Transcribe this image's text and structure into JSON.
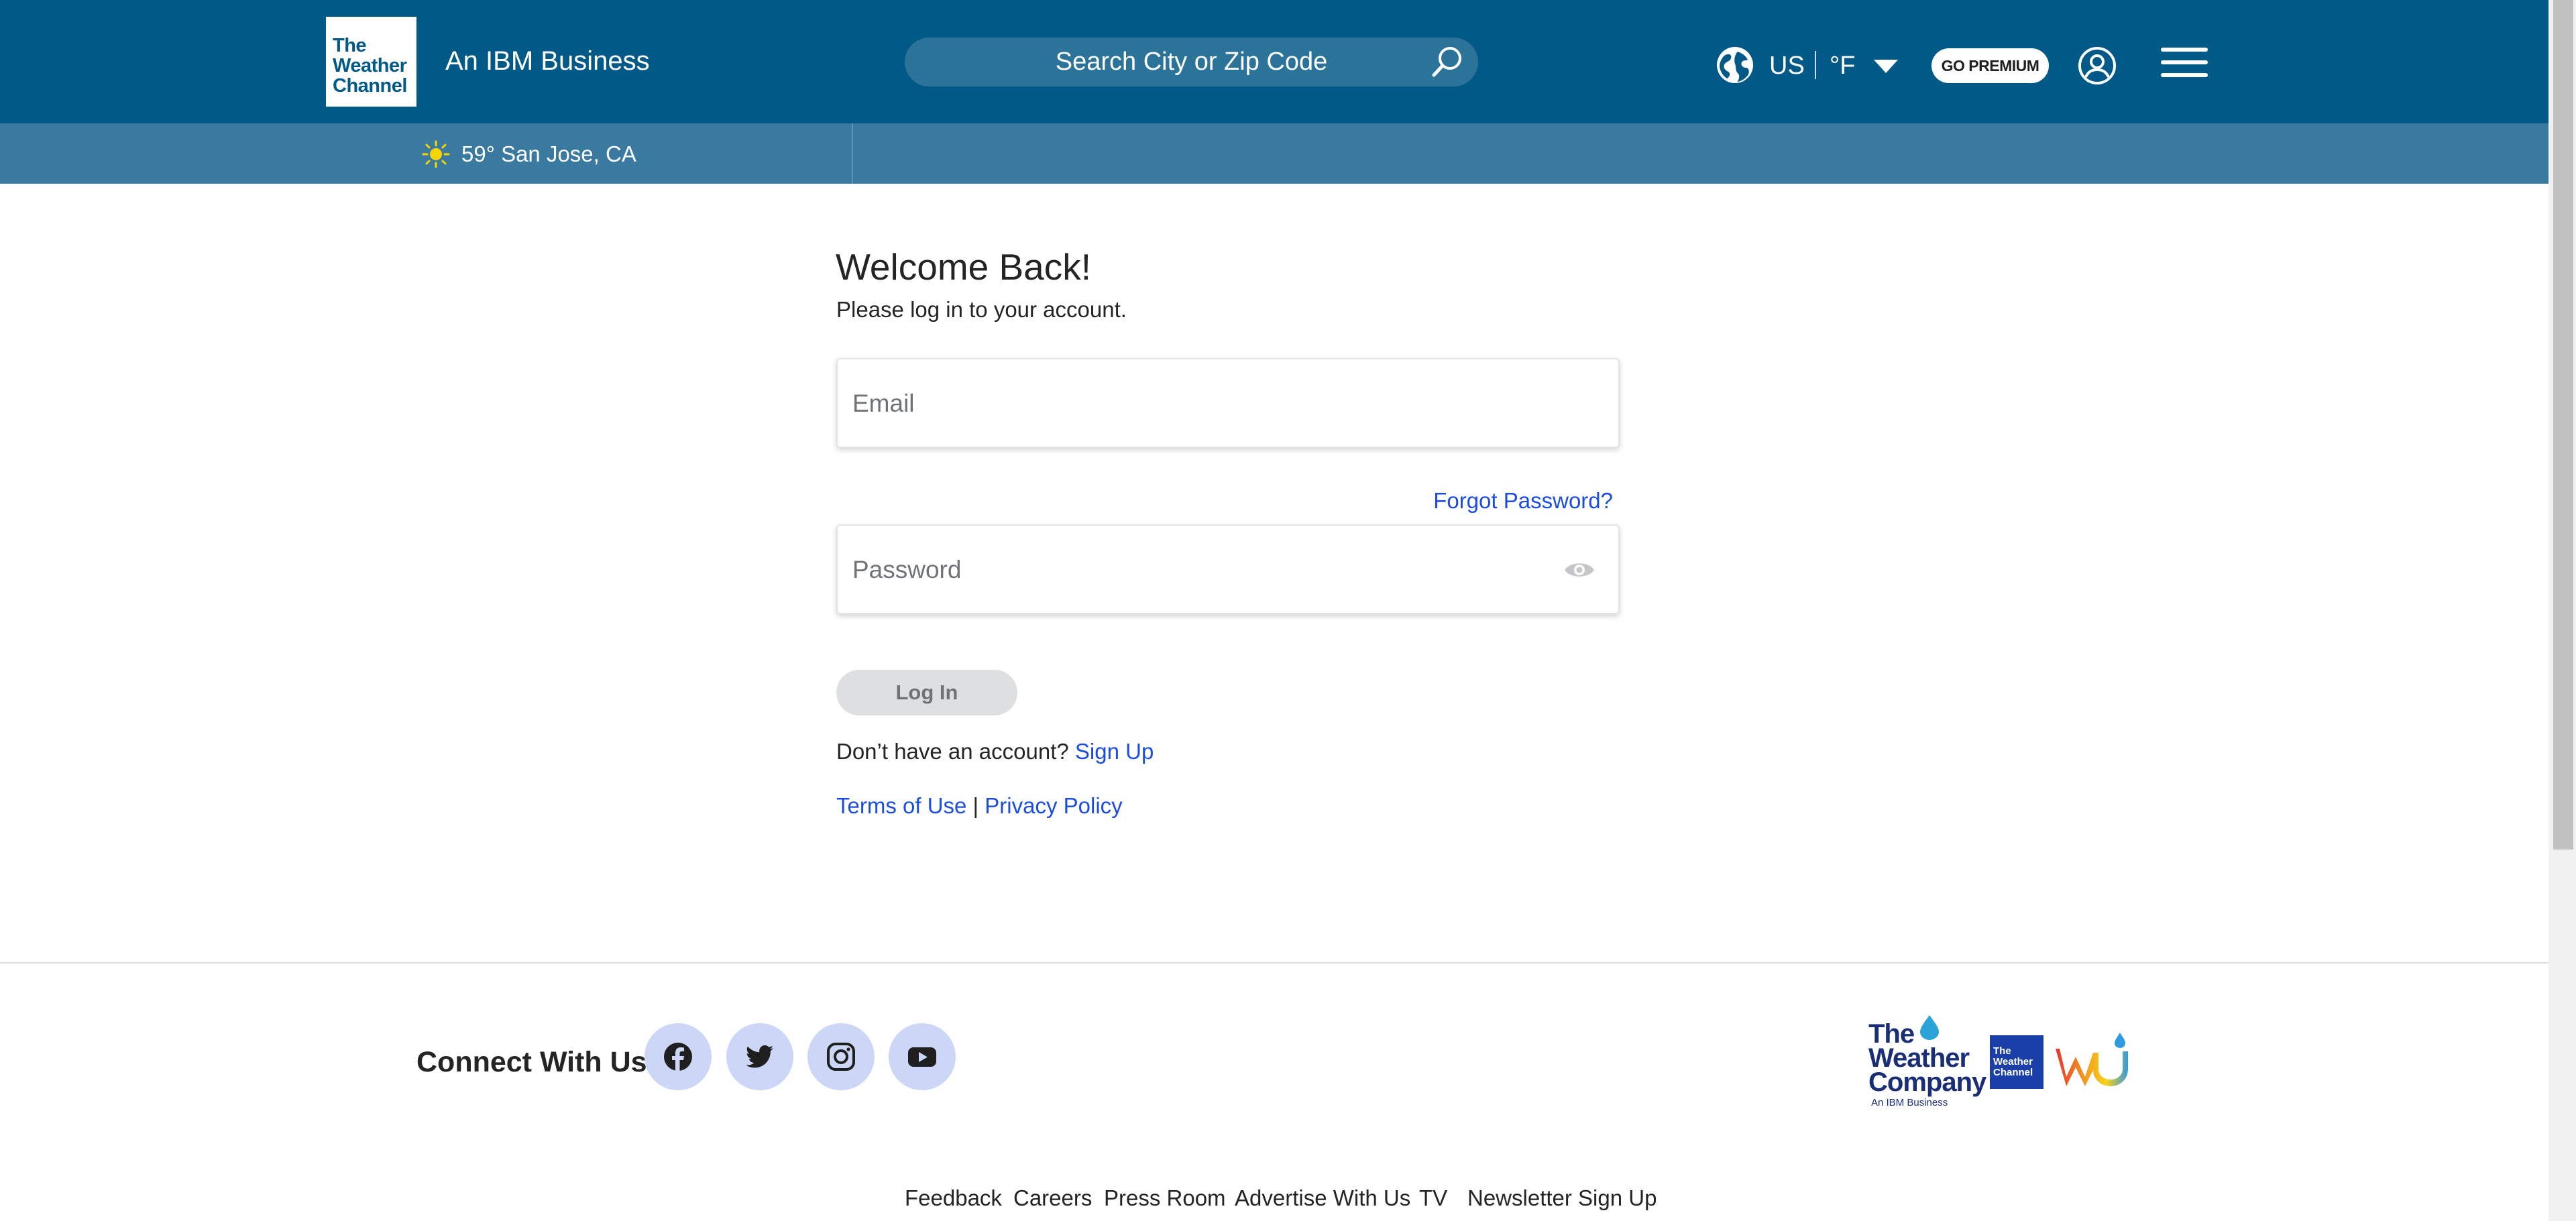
{
  "header": {
    "logo_lines": [
      "The",
      "Weather",
      "Channel"
    ],
    "ibm_text": "An IBM Business",
    "search_placeholder": "Search City or Zip Code",
    "region": "US",
    "unit": "°F",
    "premium_label": "GO PREMIUM"
  },
  "location_bar": {
    "location": "59° San Jose, CA",
    "icon": "sun-icon"
  },
  "login": {
    "title": "Welcome Back!",
    "subtitle": "Please log in to your account.",
    "email_placeholder": "Email",
    "forgot_label": "Forgot Password?",
    "password_placeholder": "Password",
    "login_label": "Log In",
    "no_account_text": "Don’t have an account? ",
    "signup_label": "Sign Up",
    "terms_label": "Terms of Use",
    "separator": " | ",
    "privacy_label": "Privacy Policy"
  },
  "footer": {
    "connect_label": "Connect With Us",
    "social": [
      "facebook-icon",
      "twitter-icon",
      "instagram-icon",
      "youtube-icon"
    ],
    "company_logo_lines": [
      "The",
      "Weather",
      "Company",
      "An IBM Business"
    ],
    "channel_logo_lines": [
      "The",
      "Weather",
      "Channel"
    ],
    "nav": [
      "Feedback",
      "Careers",
      "Press Room",
      "Advertise With Us",
      "TV",
      "Newsletter Sign Up"
    ]
  },
  "colors": {
    "header_bg": "#005986",
    "subbar_bg": "#3a7aa0",
    "link": "#1b4de4",
    "social_bg": "#ccd6f6"
  }
}
